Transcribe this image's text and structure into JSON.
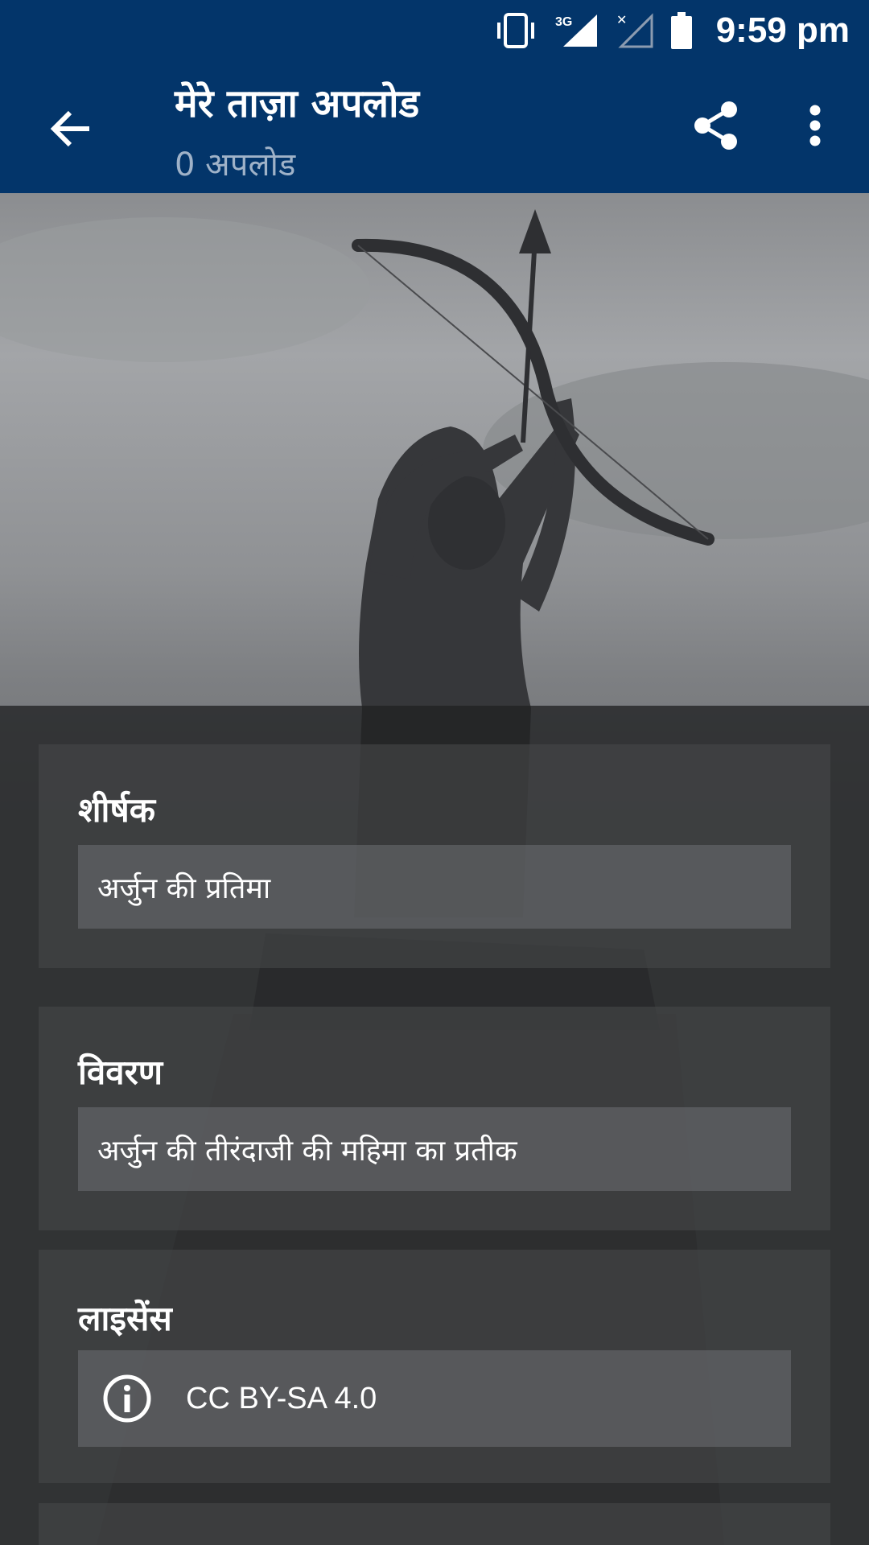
{
  "status_bar": {
    "time": "9:59 pm",
    "network": "3G",
    "icons": [
      "vibrate-icon",
      "signal-3g-icon",
      "signal-no-sim-icon",
      "battery-icon"
    ]
  },
  "toolbar": {
    "title": "मेरे ताज़ा अपलोड",
    "subtitle": "0 अपलोड",
    "icons": [
      "back-arrow-icon",
      "share-icon",
      "more-vert-icon"
    ]
  },
  "form": {
    "title_card": {
      "label": "शीर्षक",
      "value": "अर्जुन की प्रतिमा"
    },
    "description_card": {
      "label": "विवरण",
      "value": "अर्जुन की तीरंदाजी की महिमा का प्रतीक"
    },
    "license_card": {
      "label": "लाइसेंस",
      "value": "CC BY-SA 4.0",
      "icon": "info-icon"
    }
  },
  "colors": {
    "primary": "#03356a",
    "subtitle": "#9fb2c8",
    "card": "#464749",
    "field": "#6e6f72"
  }
}
